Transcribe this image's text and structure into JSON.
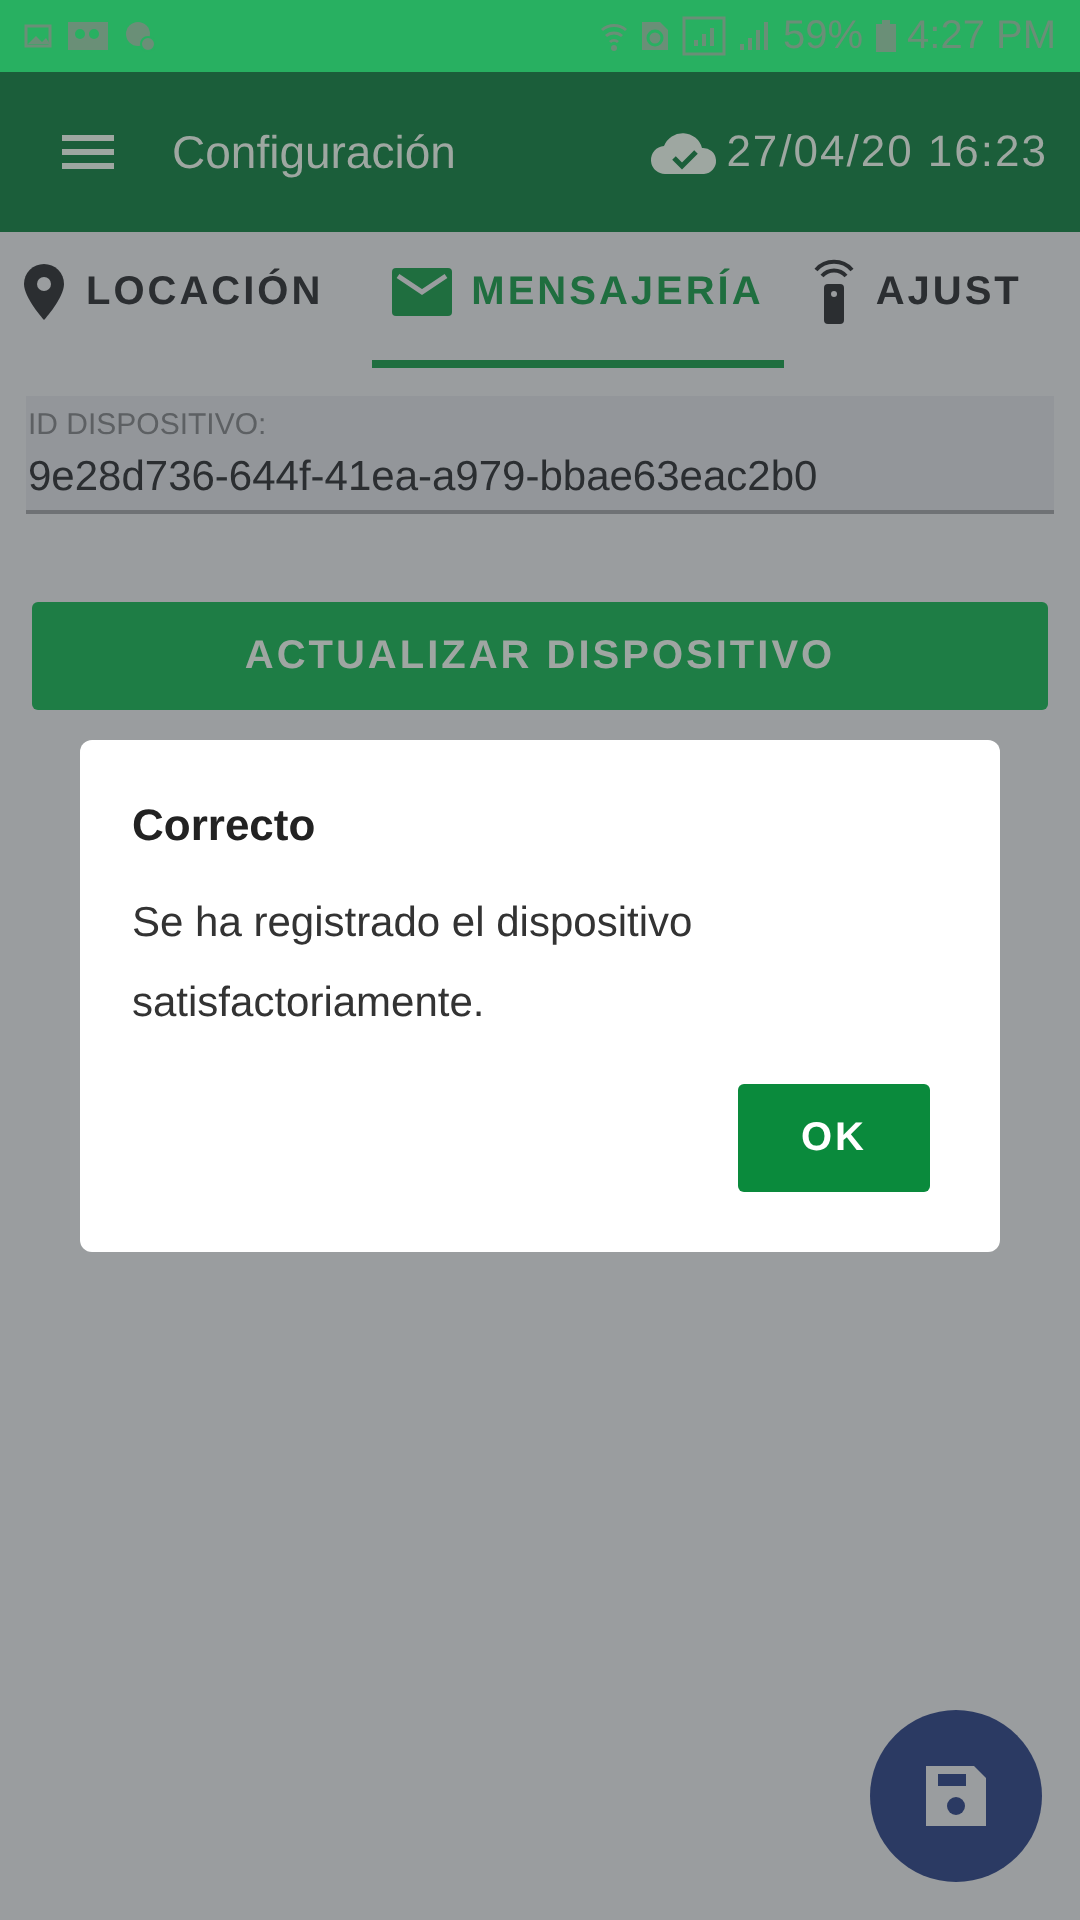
{
  "status_bar": {
    "battery": "59%",
    "time": "4:27 PM"
  },
  "app_bar": {
    "title": "Configuración",
    "sync_time": "27/04/20 16:23"
  },
  "tabs": [
    {
      "label": "LOCACIÓN",
      "kind": "pin",
      "selected": false
    },
    {
      "label": "MENSAJERÍA",
      "kind": "mail",
      "selected": true
    },
    {
      "label": "AJUST",
      "kind": "remote",
      "selected": false
    }
  ],
  "device_id": {
    "label": "ID DISPOSITIVO:",
    "value": "9e28d736-644f-41ea-a979-bbae63eac2b0"
  },
  "update_button": "ACTUALIZAR DISPOSITIVO",
  "dialog": {
    "title": "Correcto",
    "message": "Se ha registrado el dispositivo satisfactoriamente.",
    "button": "OK"
  }
}
